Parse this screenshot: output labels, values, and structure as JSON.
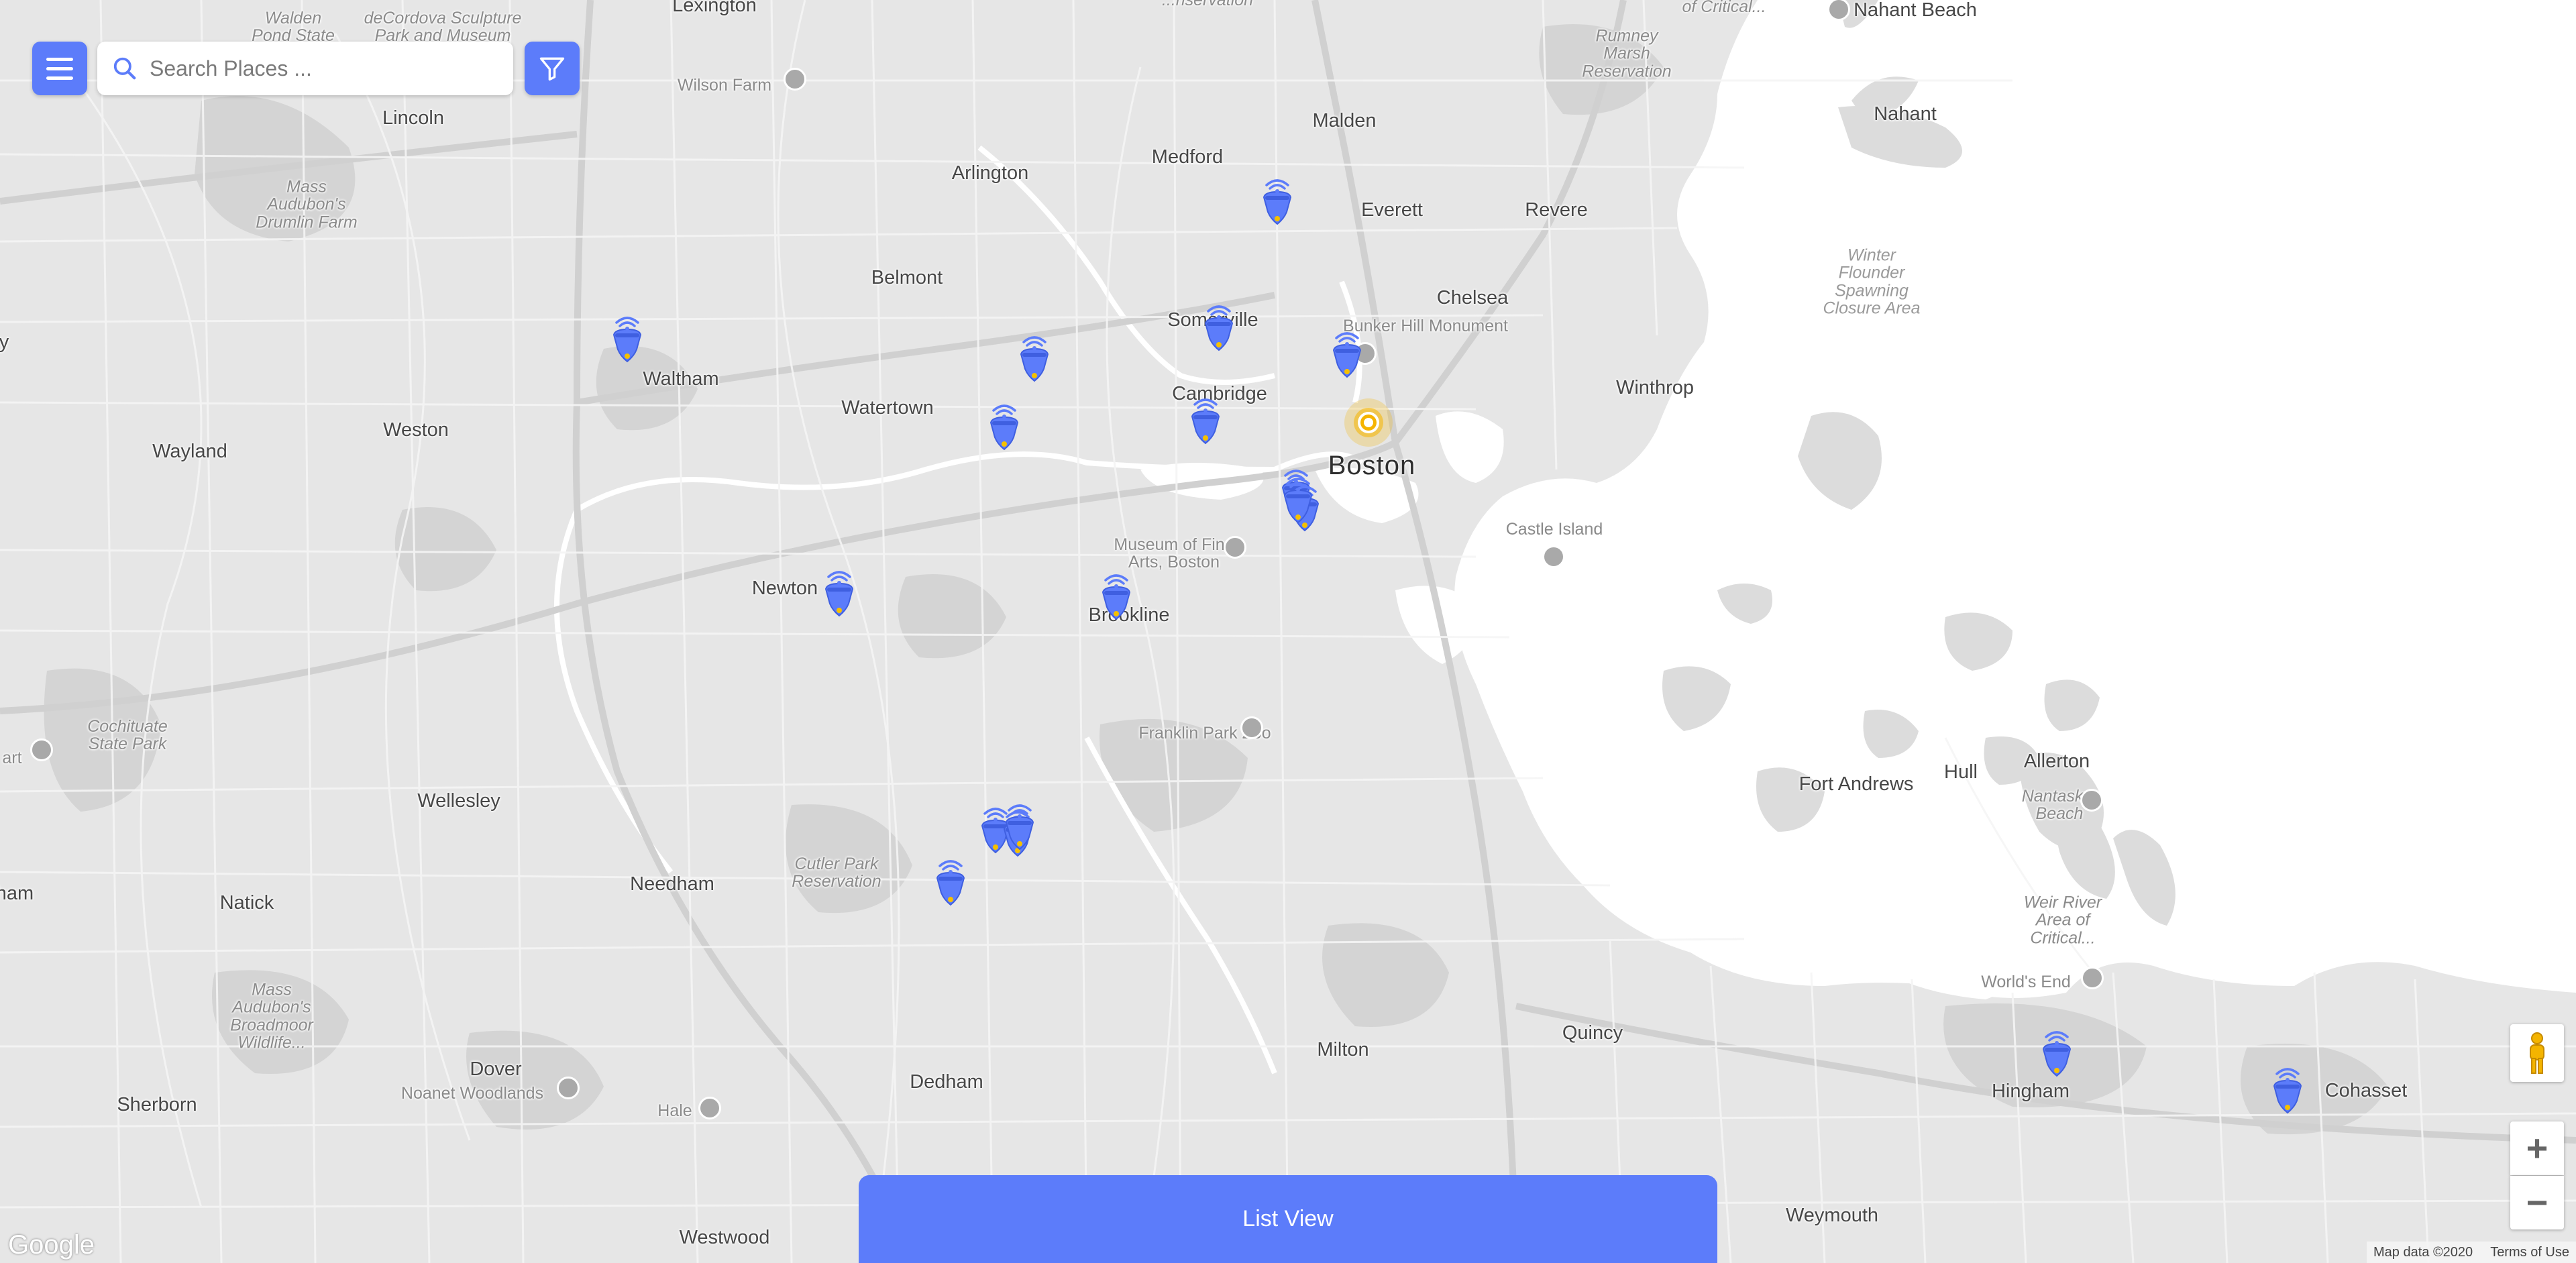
{
  "search": {
    "placeholder": "Search Places ..."
  },
  "bottom_bar": {
    "list_view_label": "List View"
  },
  "attribution": {
    "logo": "Google",
    "map_data": "Map data ©2020",
    "terms": "Terms of Use"
  },
  "colors": {
    "accent": "#5c7cfa",
    "water": "#ffffff",
    "land": "#e6e6e6",
    "park": "#d2d2d2",
    "road": "#f7f7f7"
  },
  "map_labels": {
    "walden_pond": "Walden\nPond State",
    "decordova": "deCordova Sculpture\nPark and Museum",
    "lexington": "Lexington",
    "lincoln": "Lincoln",
    "wilson_farm": "Wilson Farm",
    "mass_audubon_drumlin": "Mass\nAudubon's\nDrumlin Farm",
    "arlington": "Arlington",
    "medford": "Medford",
    "malden": "Malden",
    "everett": "Everett",
    "revere": "Revere",
    "rumney_marsh": "Rumney\nMarsh\nReservation",
    "nahant_beach": "Nahant Beach",
    "nahant": "Nahant",
    "of_critical": "of Critical...",
    "belmont": "Belmont",
    "somerville": "Somerville",
    "chelsea": "Chelsea",
    "bunker_hill": "Bunker Hill Monument",
    "winter_flounder": "Winter\nFlounder\nSpawning\nClosure Area",
    "waltham": "Waltham",
    "watertown": "Watertown",
    "cambridge": "Cambridge",
    "winthrop": "Winthrop",
    "wayland": "Wayland",
    "weston": "Weston",
    "boston": "Boston",
    "castle_island": "Castle Island",
    "museum_fine_arts": "Museum of Fine\nArts, Boston",
    "newton": "Newton",
    "brookline": "Brookline",
    "cochituate": "Cochituate\nState Park",
    "franklin_park_zoo": "Franklin Park Zoo",
    "art": "art",
    "wellesley": "Wellesley",
    "fort_andrews": "Fort Andrews",
    "hull": "Hull",
    "allerton": "Allerton",
    "nantasket": "Nantasket\nBeach",
    "cutler_park": "Cutler Park\nReservation",
    "needham": "Needham",
    "natick": "Natick",
    "ham": "ham",
    "weir_river": "Weir River\nArea of\nCritical...",
    "worlds_end": "World's End",
    "mass_audubon_broadmoor": "Mass\nAudubon's\nBroadmoor\nWildlife...",
    "milton": "Milton",
    "quincy": "Quincy",
    "dover": "Dover",
    "noanet": "Noanet Woodlands",
    "hingham": "Hingham",
    "cohasset": "Cohasset",
    "sherborn": "Sherborn",
    "hale": "Hale",
    "dedham": "Dedham",
    "westwood": "Westwood",
    "weymouth": "Weymouth",
    "rochester": "...nservation",
    "y": "y"
  },
  "markers": {
    "count": 18,
    "icon": "wifi-location-pin-icon"
  },
  "user_location": {
    "icon": "current-location-icon",
    "color": "#f5b400"
  }
}
